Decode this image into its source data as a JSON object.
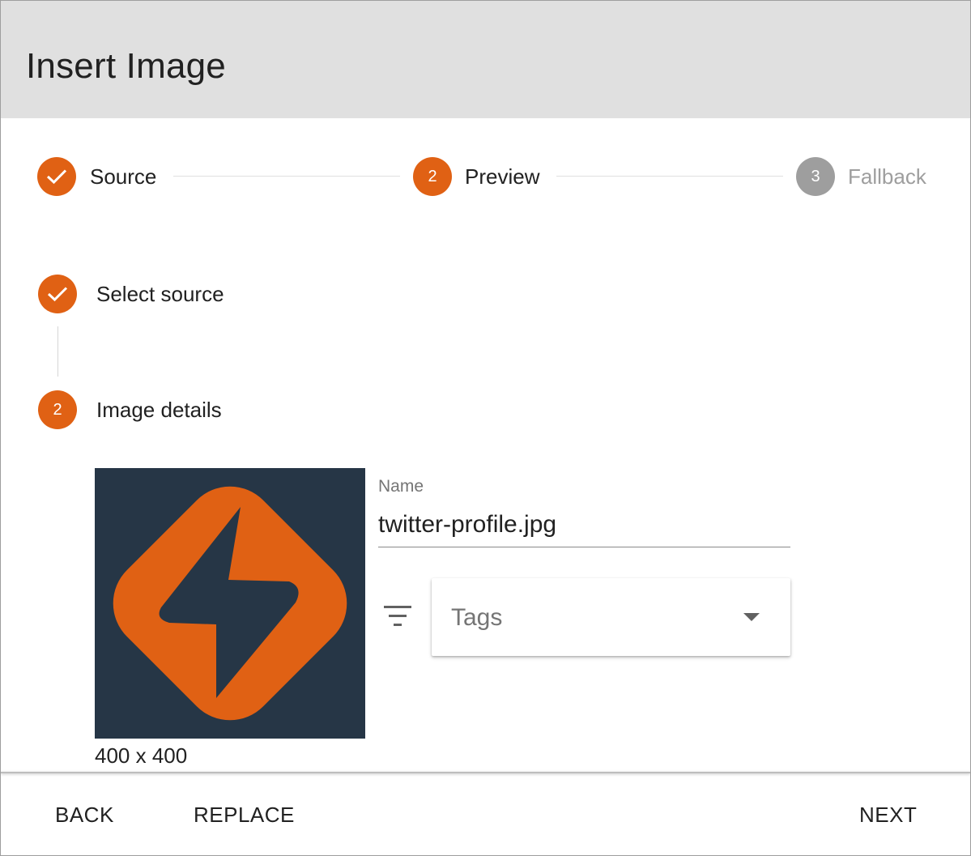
{
  "header": {
    "title": "Insert Image"
  },
  "stepper": {
    "steps": [
      {
        "number": "1",
        "label": "Source",
        "state": "complete"
      },
      {
        "number": "2",
        "label": "Preview",
        "state": "active"
      },
      {
        "number": "3",
        "label": "Fallback",
        "state": "inactive"
      }
    ]
  },
  "substeps": [
    {
      "number": "1",
      "label": "Select source",
      "state": "complete"
    },
    {
      "number": "2",
      "label": "Image details",
      "state": "active"
    }
  ],
  "image": {
    "dimensions": "400 x 400",
    "icon": "lightning-bolt-logo",
    "bg_color": "#263646",
    "accent_color": "#e06114"
  },
  "form": {
    "name_label": "Name",
    "name_value": "twitter-profile.jpg",
    "tags_placeholder": "Tags",
    "filter_icon": "filter-list-icon"
  },
  "footer": {
    "back_label": "BACK",
    "replace_label": "REPLACE",
    "next_label": "NEXT"
  },
  "colors": {
    "accent": "#e06114",
    "header_bg": "#e0e0e0",
    "inactive": "#9e9e9e"
  }
}
